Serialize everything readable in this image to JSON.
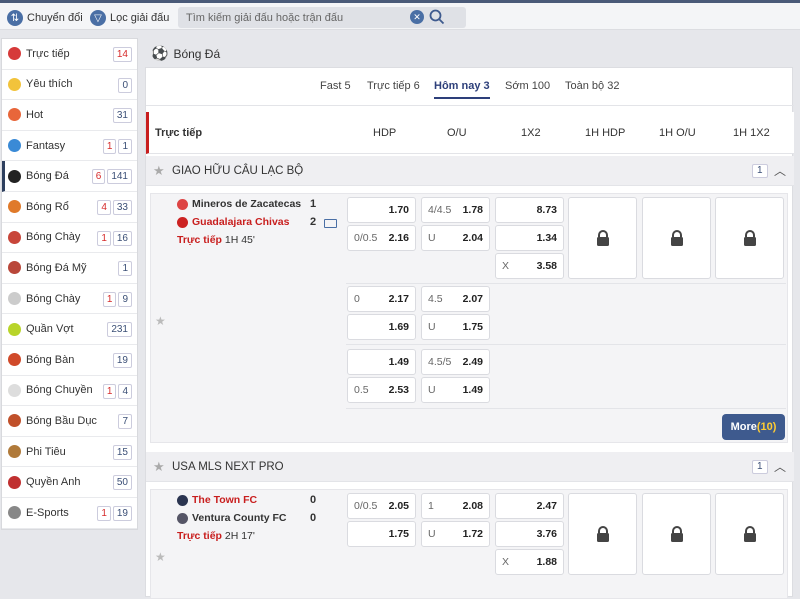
{
  "topbar": {
    "switch_label": "Chuyển đổi",
    "filter_label": "Lọc giải đấu",
    "search_placeholder": "Tìm kiếm giải đấu hoặc trận đấu"
  },
  "sidebar": {
    "items": [
      {
        "label": "Trực tiếp",
        "counts": [
          "14"
        ],
        "red": [
          true
        ],
        "icon": "live-icon",
        "color": "#d63a3a"
      },
      {
        "label": "Yêu thích",
        "counts": [
          "0"
        ],
        "red": [
          false
        ],
        "icon": "star-icon",
        "color": "#f2c33b"
      },
      {
        "label": "Hot",
        "counts": [
          "31"
        ],
        "red": [
          false
        ],
        "icon": "fire-icon",
        "color": "#e8663a"
      },
      {
        "label": "Fantasy",
        "counts": [
          "1",
          "1"
        ],
        "red": [
          true,
          false
        ],
        "icon": "fantasy-icon",
        "color": "#3a8ad6"
      },
      {
        "label": "Bóng Đá",
        "counts": [
          "6",
          "141"
        ],
        "red": [
          true,
          false
        ],
        "icon": "soccer-ball-icon",
        "color": "#222222"
      },
      {
        "label": "Bóng Rổ",
        "counts": [
          "4",
          "33"
        ],
        "red": [
          true,
          false
        ],
        "icon": "basketball-icon",
        "color": "#e07a2a"
      },
      {
        "label": "Bóng Chày",
        "counts": [
          "1",
          "16"
        ],
        "red": [
          true,
          false
        ],
        "icon": "baseball-icon",
        "color": "#c8463a"
      },
      {
        "label": "Bóng Đá Mỹ",
        "counts": [
          "1"
        ],
        "red": [
          false
        ],
        "icon": "american-football-helmet-icon",
        "color": "#b9473a"
      },
      {
        "label": "Bóng Chày",
        "counts": [
          "1",
          "9"
        ],
        "red": [
          true,
          false
        ],
        "icon": "softball-icon",
        "color": "#cccccc"
      },
      {
        "label": "Quần Vợt",
        "counts": [
          "231"
        ],
        "red": [
          false
        ],
        "icon": "tennis-ball-icon",
        "color": "#b8d42a"
      },
      {
        "label": "Bóng Bàn",
        "counts": [
          "19"
        ],
        "red": [
          false
        ],
        "icon": "table-tennis-icon",
        "color": "#d04a2a"
      },
      {
        "label": "Bóng Chuyền",
        "counts": [
          "1",
          "4"
        ],
        "red": [
          true,
          false
        ],
        "icon": "volleyball-icon",
        "color": "#dddddd"
      },
      {
        "label": "Bóng Bầu Dục",
        "counts": [
          "7"
        ],
        "red": [
          false
        ],
        "icon": "rugby-ball-icon",
        "color": "#c0502a"
      },
      {
        "label": "Phi Tiêu",
        "counts": [
          "15"
        ],
        "red": [
          false
        ],
        "icon": "darts-icon",
        "color": "#b07a3a"
      },
      {
        "label": "Quyền Anh",
        "counts": [
          "50"
        ],
        "red": [
          false
        ],
        "icon": "boxing-glove-icon",
        "color": "#c03030"
      },
      {
        "label": "E-Sports",
        "counts": [
          "1",
          "19"
        ],
        "red": [
          true,
          false
        ],
        "icon": "gamepad-icon",
        "color": "#888888"
      }
    ]
  },
  "section_title": "Bóng Đá",
  "tabs": [
    "Fast 5",
    "Trực tiếp 6",
    "Hôm nay 3",
    "Sớm 100",
    "Toàn bộ 32"
  ],
  "active_tab": "Hôm nay 3",
  "columns": {
    "live": "Trực tiếp",
    "hdp": "HDP",
    "ou": "O/U",
    "x12": "1X2",
    "h1hdp": "1H HDP",
    "h1ou": "1H O/U",
    "h1x12": "1H 1X2"
  },
  "leagues": [
    {
      "name": "GIAO HỮU CÂU LẠC BỘ",
      "count": "1",
      "home": "Mineros de Zacatecas",
      "home_score": "1",
      "away": "Guadalajara Chivas",
      "away_score": "2",
      "status": "Trực tiếp",
      "time": "1H 45'",
      "rows": [
        {
          "hdp": [
            [
              "",
              "1.70"
            ],
            [
              "0/0.5",
              "2.16"
            ]
          ],
          "ou": [
            [
              "4/4.5",
              "1.78"
            ],
            [
              "U",
              "2.04"
            ]
          ],
          "x12": [
            [
              "",
              "8.73"
            ],
            [
              "",
              "1.34"
            ],
            [
              "X",
              "3.58"
            ]
          ]
        },
        {
          "hdp": [
            [
              "0",
              "2.17"
            ],
            [
              "",
              "1.69"
            ]
          ],
          "ou": [
            [
              "4.5",
              "2.07"
            ],
            [
              "U",
              "1.75"
            ]
          ]
        },
        {
          "hdp": [
            [
              "",
              "1.49"
            ],
            [
              "0.5",
              "2.53"
            ]
          ],
          "ou": [
            [
              "4.5/5",
              "2.49"
            ],
            [
              "U",
              "1.49"
            ]
          ]
        }
      ],
      "more_label": "More",
      "more_count": "(10)"
    },
    {
      "name": "USA MLS NEXT PRO",
      "count": "1",
      "home": "The Town FC",
      "home_score": "0",
      "away": "Ventura County FC",
      "away_score": "0",
      "status": "Trực tiếp",
      "time": "2H 17'",
      "rows": [
        {
          "hdp": [
            [
              "0/0.5",
              "2.05"
            ],
            [
              "",
              "1.75"
            ]
          ],
          "ou": [
            [
              "1",
              "2.08"
            ],
            [
              "U",
              "1.72"
            ]
          ],
          "x12": [
            [
              "",
              "2.47"
            ],
            [
              "",
              "3.76"
            ],
            [
              "X",
              "1.88"
            ]
          ]
        }
      ]
    }
  ],
  "colors": {
    "accent": "#2d3f7a",
    "live_red": "#c81e1e",
    "more_btn": "#3e5a8e"
  }
}
